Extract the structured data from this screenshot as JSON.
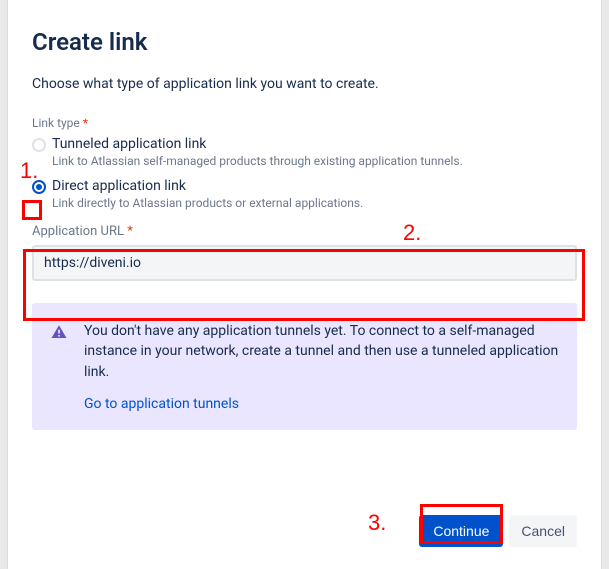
{
  "modal": {
    "title": "Create link",
    "subtitle": "Choose what type of application link you want to create.",
    "link_type_label": "Link type",
    "radios": {
      "tunneled": {
        "title": "Tunneled application link",
        "desc": "Link to Atlassian self-managed products through existing application tunnels."
      },
      "direct": {
        "title": "Direct application link",
        "desc": "Link directly to Atlassian products or external applications."
      }
    },
    "url": {
      "label": "Application URL",
      "value": "https://diveni.io"
    },
    "notice": {
      "text": "You don't have any application tunnels yet. To connect to a self-managed instance in your network, create a tunnel and then use a tunneled application link.",
      "link": "Go to application tunnels"
    },
    "actions": {
      "continue": "Continue",
      "cancel": "Cancel"
    }
  },
  "annotations": {
    "n1": "1.",
    "n2": "2.",
    "n3": "3."
  }
}
